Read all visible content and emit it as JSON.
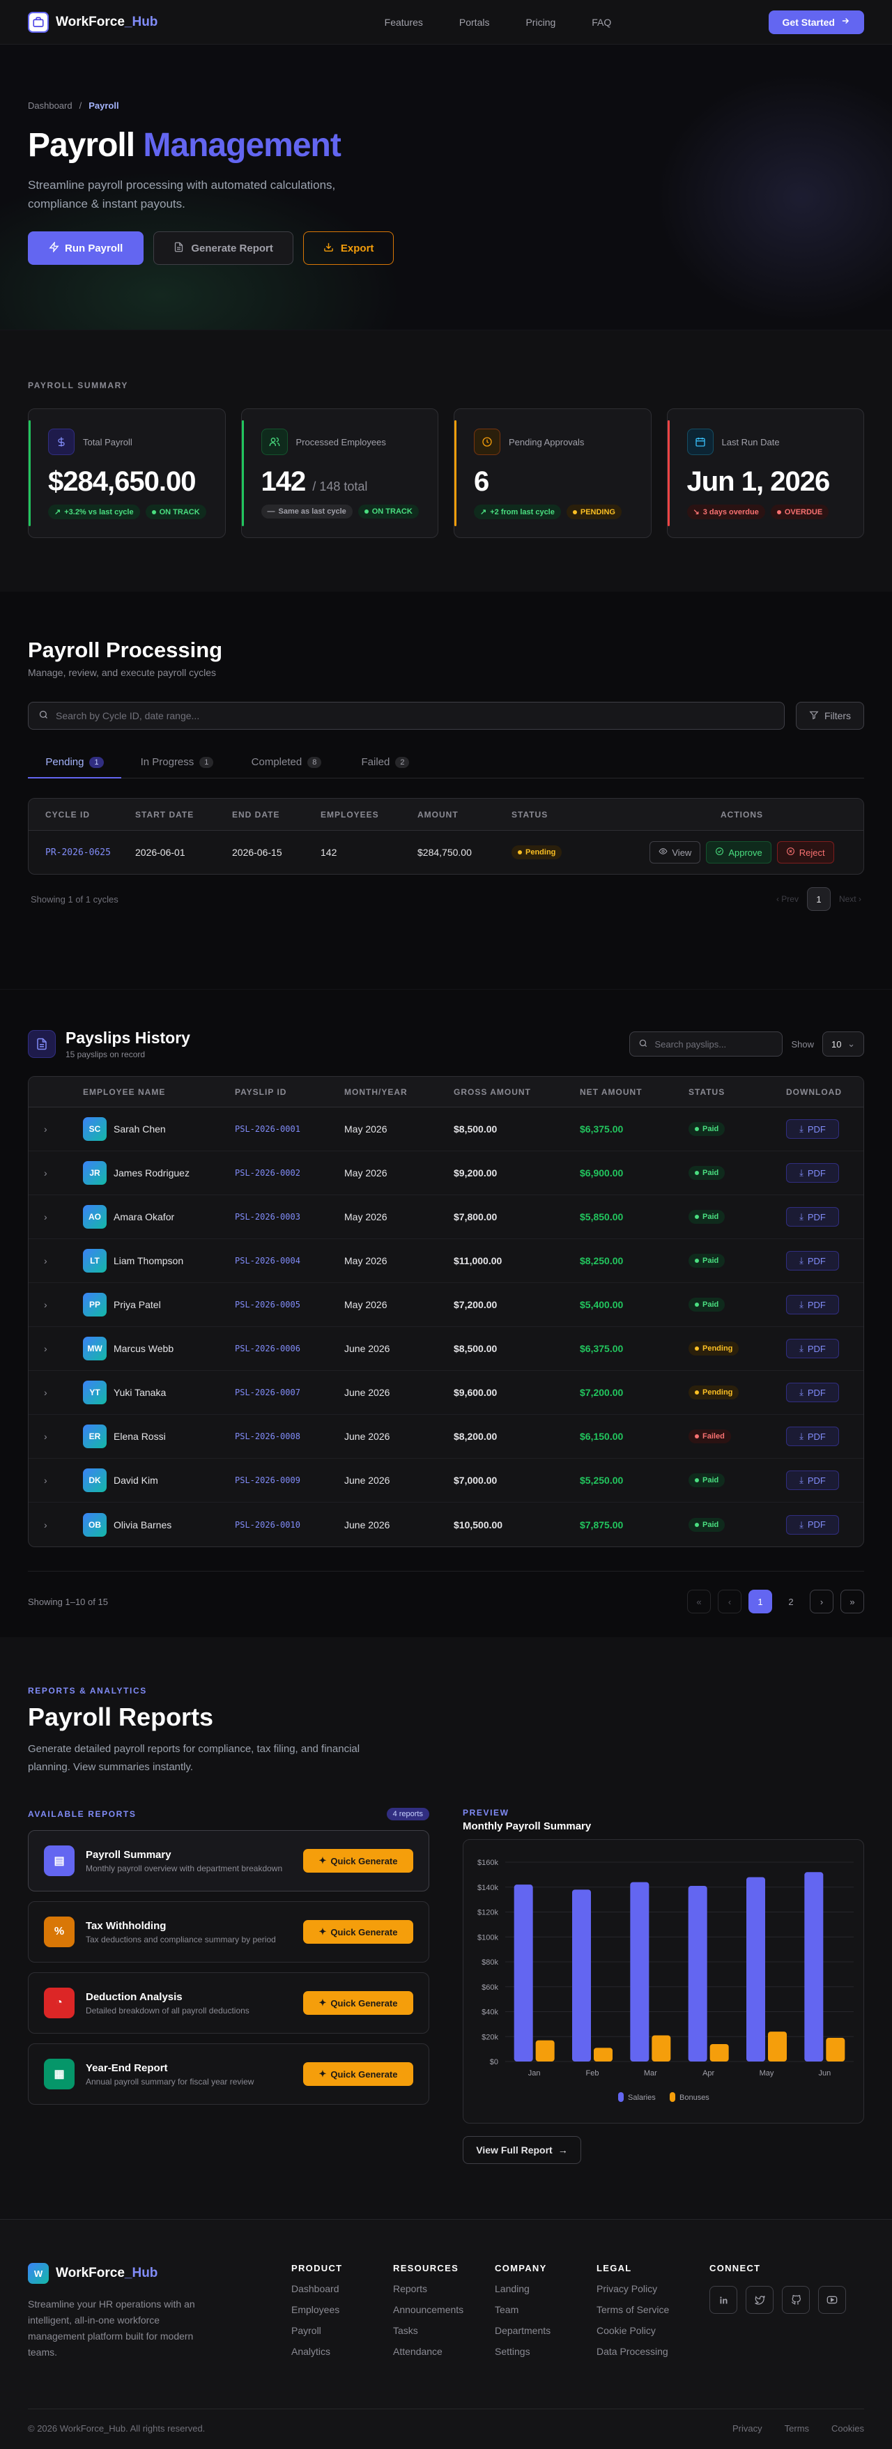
{
  "nav": {
    "brand_a": "WorkForce",
    "brand_b": "_Hub",
    "links": [
      "Features",
      "Portals",
      "Pricing",
      "FAQ"
    ],
    "cta": "Get Started"
  },
  "hero": {
    "crumb_root": "Dashboard",
    "crumb_current": "Payroll",
    "title_a": "Payroll",
    "title_b": "Management",
    "subtitle": "Streamline payroll processing with automated calculations, compliance & instant payouts.",
    "btn_run": "Run Payroll",
    "btn_report": "Generate Report",
    "btn_export": "Export"
  },
  "summary": {
    "eyebrow": "PAYROLL SUMMARY",
    "cards": [
      {
        "label": "Total Payroll",
        "value": "$284,650.00",
        "suffix": "",
        "change": "+3.2% vs last cycle",
        "status": "ON TRACK"
      },
      {
        "label": "Processed Employees",
        "value": "142",
        "suffix": "/ 148 total",
        "change": "Same as last cycle",
        "status": "ON TRACK"
      },
      {
        "label": "Pending Approvals",
        "value": "6",
        "suffix": "",
        "change": "+2 from last cycle",
        "status": "PENDING"
      },
      {
        "label": "Last Run Date",
        "value": "Jun 1, 2026",
        "suffix": "",
        "change": "3 days overdue",
        "status": "OVERDUE"
      }
    ]
  },
  "processing": {
    "title": "Payroll Processing",
    "subtitle": "Manage, review, and execute payroll cycles",
    "search_placeholder": "Search by Cycle ID, date range...",
    "filters": "Filters",
    "tabs": [
      {
        "label": "Pending",
        "count": "1"
      },
      {
        "label": "In Progress",
        "count": "1"
      },
      {
        "label": "Completed",
        "count": "8"
      },
      {
        "label": "Failed",
        "count": "2"
      }
    ],
    "columns": [
      "CYCLE ID",
      "START DATE",
      "END DATE",
      "EMPLOYEES",
      "AMOUNT",
      "STATUS",
      "ACTIONS"
    ],
    "row": {
      "id": "PR-2026-0625",
      "start": "2026-06-01",
      "end": "2026-06-15",
      "employees": "142",
      "amount": "$284,750.00",
      "status": "Pending"
    },
    "actions": [
      "View",
      "Approve",
      "Reject"
    ],
    "showing": "Showing 1 of 1 cycles",
    "prev": "Prev",
    "next": "Next",
    "page": "1"
  },
  "payslips": {
    "title": "Payslips History",
    "count": "15 payslips on record",
    "search_placeholder": "Search payslips...",
    "show_label": "Show",
    "show_value": "10",
    "columns": [
      "EMPLOYEE NAME",
      "PAYSLIP ID",
      "MONTH/YEAR",
      "GROSS AMOUNT",
      "NET AMOUNT",
      "STATUS",
      "DOWNLOAD"
    ],
    "pdf_label": "PDF",
    "rows": [
      {
        "initials": "SC",
        "name": "Sarah Chen",
        "id": "PSL-2026-0001",
        "month": "May 2026",
        "gross": "$8,500.00",
        "net": "$6,375.00",
        "status": "Paid"
      },
      {
        "initials": "JR",
        "name": "James Rodriguez",
        "id": "PSL-2026-0002",
        "month": "May 2026",
        "gross": "$9,200.00",
        "net": "$6,900.00",
        "status": "Paid"
      },
      {
        "initials": "AO",
        "name": "Amara Okafor",
        "id": "PSL-2026-0003",
        "month": "May 2026",
        "gross": "$7,800.00",
        "net": "$5,850.00",
        "status": "Paid"
      },
      {
        "initials": "LT",
        "name": "Liam Thompson",
        "id": "PSL-2026-0004",
        "month": "May 2026",
        "gross": "$11,000.00",
        "net": "$8,250.00",
        "status": "Paid"
      },
      {
        "initials": "PP",
        "name": "Priya Patel",
        "id": "PSL-2026-0005",
        "month": "May 2026",
        "gross": "$7,200.00",
        "net": "$5,400.00",
        "status": "Paid"
      },
      {
        "initials": "MW",
        "name": "Marcus Webb",
        "id": "PSL-2026-0006",
        "month": "June 2026",
        "gross": "$8,500.00",
        "net": "$6,375.00",
        "status": "Pending"
      },
      {
        "initials": "YT",
        "name": "Yuki Tanaka",
        "id": "PSL-2026-0007",
        "month": "June 2026",
        "gross": "$9,600.00",
        "net": "$7,200.00",
        "status": "Pending"
      },
      {
        "initials": "ER",
        "name": "Elena Rossi",
        "id": "PSL-2026-0008",
        "month": "June 2026",
        "gross": "$8,200.00",
        "net": "$6,150.00",
        "status": "Failed"
      },
      {
        "initials": "DK",
        "name": "David Kim",
        "id": "PSL-2026-0009",
        "month": "June 2026",
        "gross": "$7,000.00",
        "net": "$5,250.00",
        "status": "Paid"
      },
      {
        "initials": "OB",
        "name": "Olivia Barnes",
        "id": "PSL-2026-0010",
        "month": "June 2026",
        "gross": "$10,500.00",
        "net": "$7,875.00",
        "status": "Paid"
      }
    ],
    "showing": "Showing 1–10 of 15",
    "pages": [
      "1",
      "2"
    ]
  },
  "reports": {
    "eyebrow": "REPORTS & ANALYTICS",
    "title": "Payroll Reports",
    "desc": "Generate detailed payroll reports for compliance, tax filing, and financial planning. View summaries instantly.",
    "available": "AVAILABLE REPORTS",
    "available_count": "4 reports",
    "quick": "Quick Generate",
    "items": [
      {
        "title": "Payroll Summary",
        "desc": "Monthly payroll overview with department breakdown",
        "color": "#6366f1"
      },
      {
        "title": "Tax Withholding",
        "desc": "Tax deductions and compliance summary by period",
        "color": "#d97706"
      },
      {
        "title": "Deduction Analysis",
        "desc": "Detailed breakdown of all payroll deductions",
        "color": "#dc2626"
      },
      {
        "title": "Year-End Report",
        "desc": "Annual payroll summary for fiscal year review",
        "color": "#059669"
      }
    ],
    "preview": "PREVIEW",
    "preview_title": "Monthly Payroll Summary",
    "view_full": "View Full Report"
  },
  "chart_data": {
    "type": "bar",
    "title": "",
    "categories": [
      "Jan",
      "Feb",
      "Mar",
      "Apr",
      "May",
      "Jun"
    ],
    "series": [
      {
        "name": "Salaries",
        "color": "#6366f1",
        "values": [
          142000,
          138000,
          144000,
          141000,
          148000,
          152000
        ]
      },
      {
        "name": "Bonuses",
        "color": "#f59e0b",
        "values": [
          17000,
          11000,
          21000,
          14000,
          24000,
          19000
        ]
      }
    ],
    "y_ticks": [
      "$0",
      "$20k",
      "$40k",
      "$60k",
      "$80k",
      "$100k",
      "$120k",
      "$140k",
      "$160k"
    ],
    "ylim": [
      0,
      160000
    ],
    "grid": true,
    "legend": "bottom"
  },
  "footer": {
    "brand_a": "WorkForce",
    "brand_b": "_Hub",
    "desc": "Streamline your HR operations with an intelligent, all-in-one workforce management platform built for modern teams.",
    "cols": [
      {
        "title": "PRODUCT",
        "links": [
          "Dashboard",
          "Employees",
          "Payroll",
          "Analytics"
        ]
      },
      {
        "title": "RESOURCES",
        "links": [
          "Reports",
          "Announcements",
          "Tasks",
          "Attendance"
        ]
      },
      {
        "title": "COMPANY",
        "links": [
          "Landing",
          "Team",
          "Departments",
          "Settings"
        ]
      },
      {
        "title": "LEGAL",
        "links": [
          "Privacy Policy",
          "Terms of Service",
          "Cookie Policy",
          "Data Processing"
        ]
      }
    ],
    "connect": "CONNECT",
    "copyright": "© 2026 WorkForce_Hub. All rights reserved.",
    "bottom_links": [
      "Privacy",
      "Terms",
      "Cookies"
    ]
  },
  "icons": {
    "brand": "briefcase-icon",
    "summary": [
      "dollar-icon",
      "users-icon",
      "clock-icon",
      "calendar-icon"
    ],
    "social": [
      "linkedin-icon",
      "twitter-icon",
      "github-icon",
      "youtube-icon"
    ]
  },
  "colors": {
    "accent": "#6366f1",
    "amber": "#f59e0b",
    "green": "#22c55e",
    "red": "#ef4444"
  }
}
